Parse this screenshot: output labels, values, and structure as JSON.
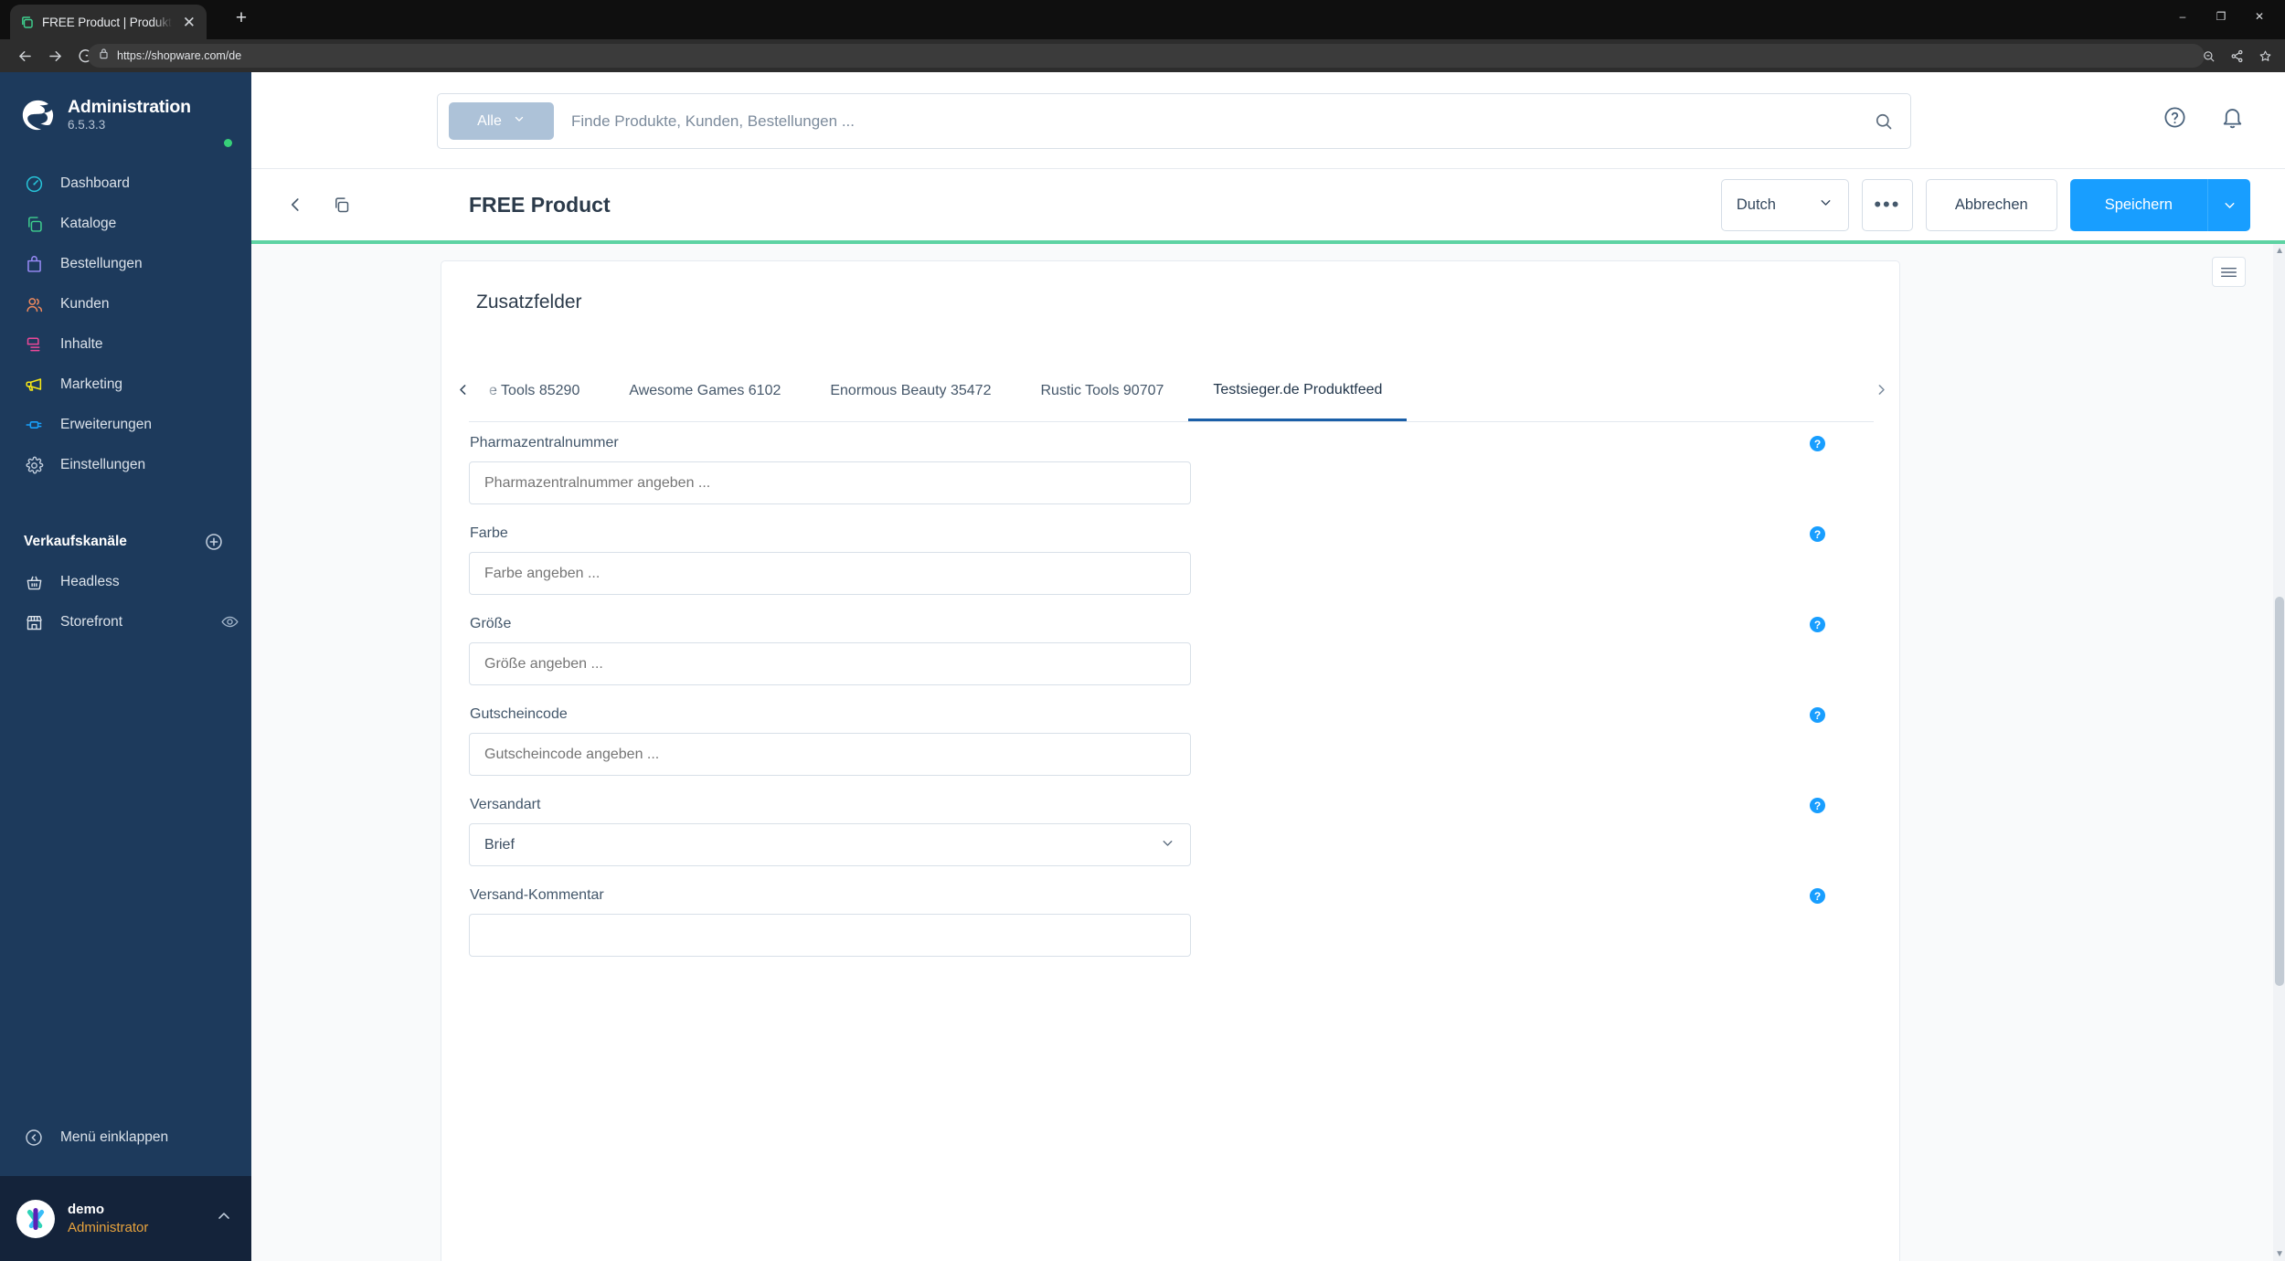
{
  "browser": {
    "tab_title": "FREE Product | Produkte",
    "tab_close_glyph": "✕",
    "new_tab_glyph": "+",
    "url": "https://shopware.com/de",
    "window_minimize": "–",
    "window_maximize": "❐",
    "window_close": "✕"
  },
  "sidebar": {
    "brand_title": "Administration",
    "brand_version": "6.5.3.3",
    "status_color": "#37d079",
    "nav": [
      {
        "label": "Dashboard",
        "icon": "speedometer-icon",
        "color": "#27c4d9"
      },
      {
        "label": "Kataloge",
        "icon": "copy-icon",
        "color": "#3ecf8e"
      },
      {
        "label": "Bestellungen",
        "icon": "bag-icon",
        "color": "#9b8cfa"
      },
      {
        "label": "Kunden",
        "icon": "users-icon",
        "color": "#f08a5d"
      },
      {
        "label": "Inhalte",
        "icon": "content-icon",
        "color": "#ec4899"
      },
      {
        "label": "Marketing",
        "icon": "megaphone-icon",
        "color": "#f5e616"
      },
      {
        "label": "Erweiterungen",
        "icon": "plug-icon",
        "color": "#18a0fb"
      },
      {
        "label": "Einstellungen",
        "icon": "gear-icon",
        "color": "#c2cedd"
      }
    ],
    "channels_title": "Verkaufskanäle",
    "channels": [
      {
        "label": "Headless",
        "icon": "basket-icon"
      },
      {
        "label": "Storefront",
        "icon": "store-icon"
      }
    ],
    "collapse_label": "Menü einklappen",
    "user_name": "demo",
    "user_role": "Administrator",
    "user_role_color": "#e8a33d"
  },
  "search": {
    "scope_label": "Alle",
    "placeholder": "Finde Produkte, Kunden, Bestellungen ..."
  },
  "header": {
    "page_title": "FREE Product",
    "language": "Dutch",
    "more_label": "•••",
    "cancel_label": "Abbrechen",
    "save_label": "Speichern",
    "accent_color": "#5ed3a3",
    "primary_color": "#189eff"
  },
  "card": {
    "title": "Zusatzfelder",
    "tabs": [
      {
        "label": "e Tools 85290",
        "active": false
      },
      {
        "label": "Awesome Games 6102",
        "active": false
      },
      {
        "label": "Enormous Beauty 35472",
        "active": false
      },
      {
        "label": "Rustic Tools 90707",
        "active": false
      },
      {
        "label": "Testsieger.de Produktfeed",
        "active": true
      }
    ],
    "fields": [
      {
        "label": "Pharmazentralnummer",
        "value": "",
        "placeholder": "Pharmazentralnummer angeben ...",
        "type": "text",
        "help": "?"
      },
      {
        "label": "Farbe",
        "value": "",
        "placeholder": "Farbe angeben ...",
        "type": "text",
        "help": "?"
      },
      {
        "label": "Größe",
        "value": "",
        "placeholder": "Größe angeben ...",
        "type": "text",
        "help": "?"
      },
      {
        "label": "Gutscheincode",
        "value": "",
        "placeholder": "Gutscheincode angeben ...",
        "type": "text",
        "help": "?"
      },
      {
        "label": "Versandart",
        "value": "Brief",
        "placeholder": "",
        "type": "select",
        "help": "?"
      },
      {
        "label": "Versand-Kommentar",
        "value": "",
        "placeholder": "",
        "type": "text",
        "help": "?"
      }
    ]
  }
}
